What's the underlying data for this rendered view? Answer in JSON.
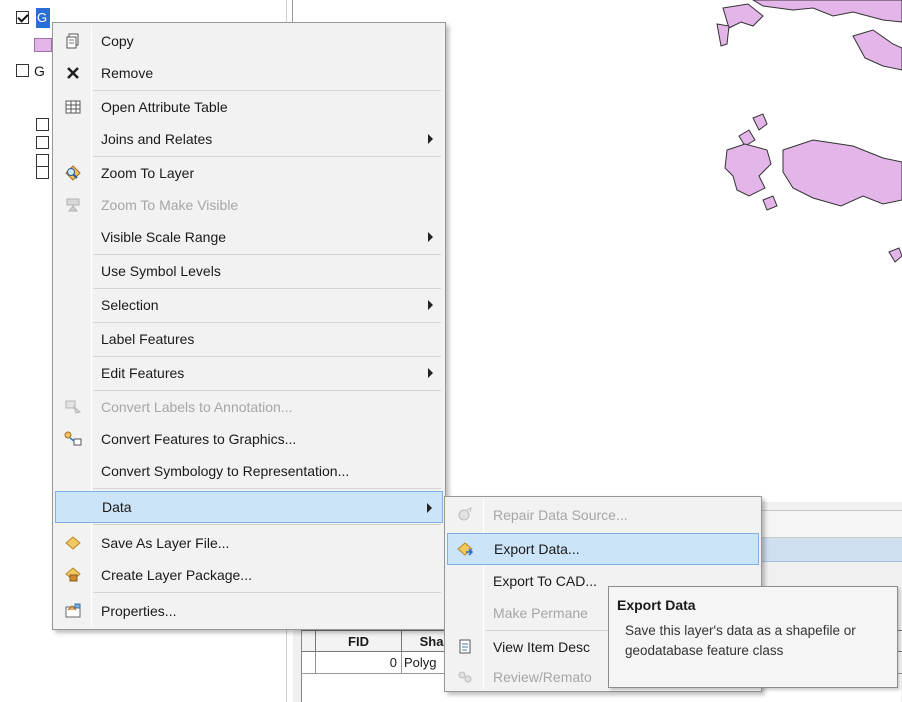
{
  "toc": {
    "layers": [
      {
        "name": "G",
        "checked": true
      },
      {
        "name": "G",
        "checked": false
      }
    ],
    "sublayer_checkboxes": 4,
    "swatch_color": "#e3b5e8"
  },
  "context_menu": {
    "items": [
      {
        "label": "Copy",
        "icon": "copy-icon",
        "enabled": true
      },
      {
        "label": "Remove",
        "icon": "remove-x-icon",
        "enabled": true
      },
      {
        "label": "Open Attribute Table",
        "icon": "table-icon",
        "enabled": true
      },
      {
        "label": "Joins and Relates",
        "icon": "",
        "enabled": true,
        "submenu": true
      },
      {
        "label": "Zoom To Layer",
        "icon": "zoom-layer-icon",
        "enabled": true
      },
      {
        "label": "Zoom To Make Visible",
        "icon": "zoom-visible-icon",
        "enabled": false
      },
      {
        "label": "Visible Scale Range",
        "icon": "",
        "enabled": true,
        "submenu": true
      },
      {
        "label": "Use Symbol Levels",
        "icon": "",
        "enabled": true
      },
      {
        "label": "Selection",
        "icon": "",
        "enabled": true,
        "submenu": true
      },
      {
        "label": "Label Features",
        "icon": "",
        "enabled": true
      },
      {
        "label": "Edit Features",
        "icon": "",
        "enabled": true,
        "submenu": true
      },
      {
        "label": "Convert Labels to Annotation...",
        "icon": "annotation-icon",
        "enabled": false
      },
      {
        "label": "Convert Features to Graphics...",
        "icon": "graphics-icon",
        "enabled": true
      },
      {
        "label": "Convert Symbology to Representation...",
        "icon": "",
        "enabled": true
      },
      {
        "label": "Data",
        "icon": "",
        "enabled": true,
        "submenu": true,
        "highlighted": true
      },
      {
        "label": "Save As Layer File...",
        "icon": "layer-file-icon",
        "enabled": true
      },
      {
        "label": "Create Layer Package...",
        "icon": "layer-package-icon",
        "enabled": true
      },
      {
        "label": "Properties...",
        "icon": "properties-icon",
        "enabled": true
      }
    ]
  },
  "data_submenu": {
    "items": [
      {
        "label": "Repair Data Source...",
        "icon": "repair-icon",
        "enabled": false
      },
      {
        "label": "Export Data...",
        "icon": "export-data-icon",
        "enabled": true,
        "highlighted": true
      },
      {
        "label": "Export To CAD...",
        "icon": "",
        "enabled": true
      },
      {
        "label": "Make Permane",
        "icon": "",
        "enabled": false
      },
      {
        "label": "View Item Desc",
        "icon": "item-description-icon",
        "enabled": true
      },
      {
        "label": "Review/Remato",
        "icon": "review-icon",
        "enabled": false
      }
    ]
  },
  "tooltip": {
    "title": "Export Data",
    "body": "Save this layer's data as a shapefile or geodatabase feature class"
  },
  "attribute_table": {
    "columns": [
      "",
      "FID",
      "Sha"
    ],
    "rows": [
      [
        "",
        "0",
        "Polyg"
      ]
    ]
  },
  "colors": {
    "highlight": "#cce4f7",
    "highlight_border": "#7fb2e0",
    "polygon_fill": "#e3b5e8",
    "selection_blue": "#2a6fd6"
  }
}
